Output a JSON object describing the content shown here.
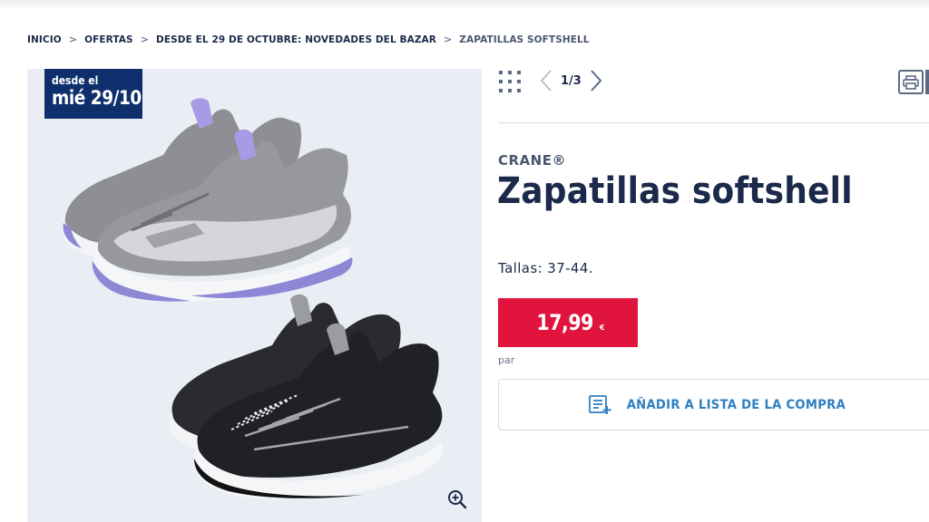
{
  "breadcrumb": {
    "items": [
      "INICIO",
      "OFERTAS",
      "DESDE EL 29 DE OCTUBRE: NOVEDADES DEL BAZAR",
      "ZAPATILLAS SOFTSHELL"
    ],
    "separator": ">"
  },
  "gallery": {
    "badge_line1": "desde el",
    "badge_line2": "mié 29/10",
    "zoom_icon": "zoom-in-icon",
    "image": "softshell-sneakers-grey-and-black"
  },
  "pager": {
    "current": "1/3",
    "prev_icon": "chevron-left-icon",
    "next_icon": "chevron-right-icon",
    "grid_icon": "grid-icon"
  },
  "toolbar": {
    "print_icon": "print-icon"
  },
  "product": {
    "brand": "CRANE®",
    "title": "Zapatillas softshell",
    "sizes": "Tallas: 37-44.",
    "price": "17,99",
    "currency": "€",
    "unit_label": "par",
    "add_to_list_label": "AÑADIR A LISTA DE LA COMPRA",
    "add_to_list_icon": "shopping-list-add-icon"
  },
  "colors": {
    "navy": "#1b2a4a",
    "badge_blue": "#0f2f6c",
    "price_red": "#e0143c",
    "link_blue": "#2f7fc1",
    "gallery_bg": "#eaeef4"
  }
}
